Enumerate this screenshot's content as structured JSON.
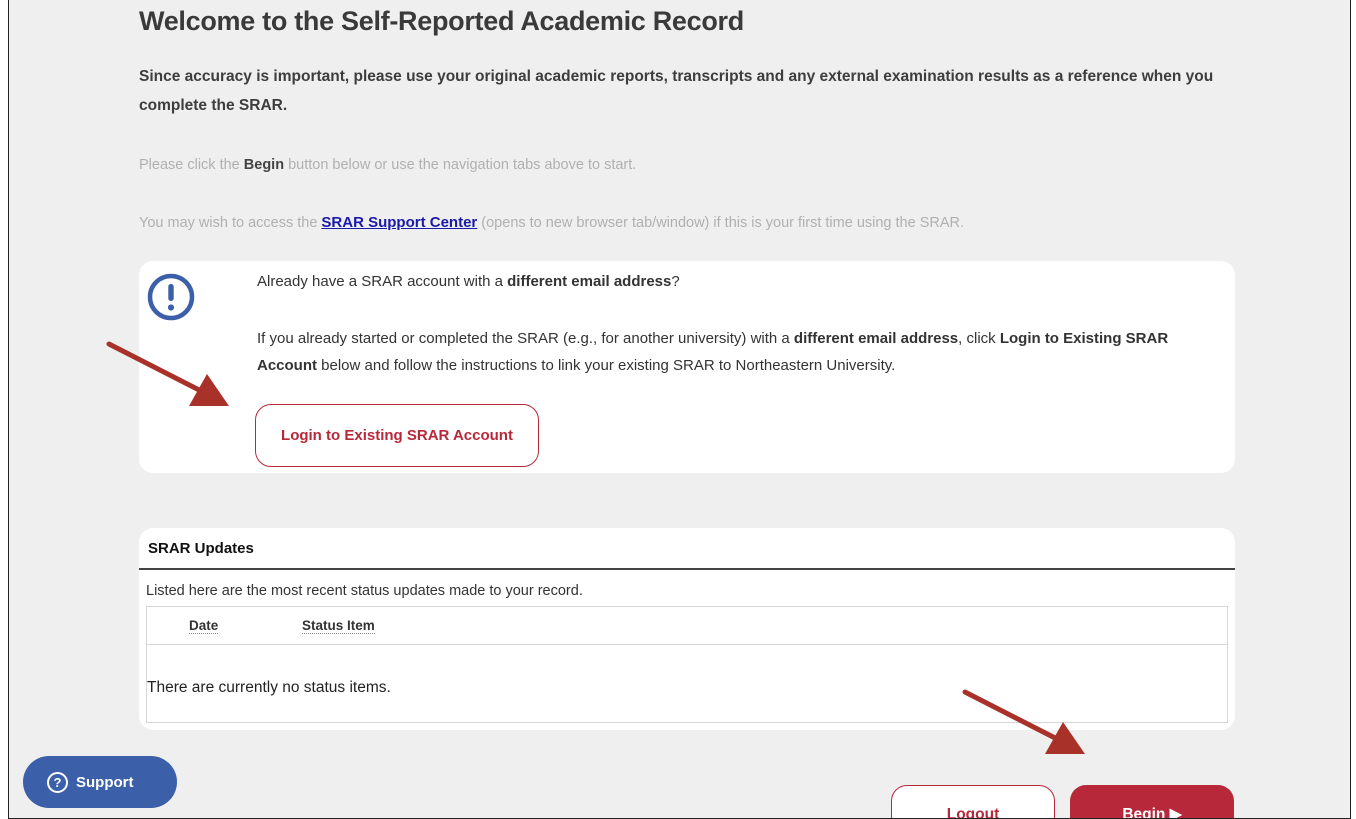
{
  "page": {
    "title": "Welcome to the Self-Reported Academic Record",
    "intro": "Since accuracy is important, please use your original academic reports, transcripts and any external examination results as a reference when you complete the SRAR.",
    "instructions": {
      "prefix": "Please click the ",
      "emphasis": "Begin",
      "suffix": " button below or use the navigation tabs above to start."
    },
    "support_note": {
      "prefix": "You may wish to access the ",
      "link": "SRAR Support Center",
      "suffix": " (opens to new browser tab/window) if this is your first time using the SRAR."
    }
  },
  "alert": {
    "line1_prefix": "Already have a SRAR account with a ",
    "line1_bold": "different email address",
    "line1_suffix": "?",
    "line2_part1": "If you already started or completed the SRAR (e.g., for another university) with a ",
    "line2_bold1": "different email address",
    "line2_part2": ", click ",
    "line2_bold2": "Login to Existing SRAR Account",
    "line2_part3": " below and follow the instructions to link your existing SRAR to Northeastern University.",
    "login_button": "Login to Existing SRAR Account",
    "icon": "exclamation-circle-icon",
    "icon_color": "#3b5fa8"
  },
  "updates": {
    "title": "SRAR Updates",
    "description": "Listed here are the most recent status updates made to your record.",
    "columns": [
      "Date",
      "Status Item"
    ],
    "rows": [],
    "empty_message": "There are currently no status items."
  },
  "buttons": {
    "support": "Support",
    "logout": "Logout",
    "begin": "Begin ▶"
  },
  "colors": {
    "accent": "#b8283b",
    "support_bg": "#3b5fa8",
    "annotation_arrow": "#a8322a",
    "link": "#1a1aa8"
  }
}
